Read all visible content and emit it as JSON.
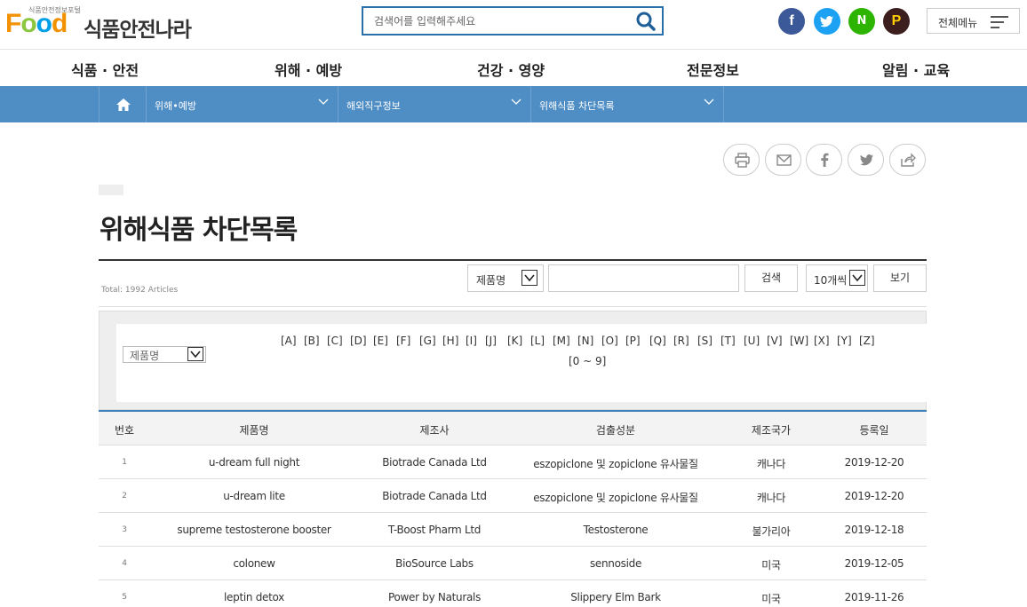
{
  "header": {
    "logo_small": "식품안전정보포털",
    "logo_food": [
      "F",
      "o",
      "o",
      "d"
    ],
    "logo_name": "식품안전나라",
    "search_placeholder": "검색어를 입력해주세요",
    "sns": {
      "facebook": "f",
      "naver": "N",
      "kakao": "P"
    },
    "menu_all": "전체메뉴"
  },
  "gnb": [
    "식품 · 안전",
    "위해 · 예방",
    "건강 · 영양",
    "전문정보",
    "알림 · 교육"
  ],
  "location": [
    "위해•예방",
    "해외직구정보",
    "위해식품 차단목록"
  ],
  "page_title": "위해식품 차단목록",
  "toolbar": {
    "total": "Total: 1992 Articles",
    "field_select": "제품명",
    "search_button": "검색",
    "count_select": "10개씩",
    "view_button": "보기"
  },
  "alpha": {
    "select": "제품명",
    "letters": [
      "[A]",
      "[B]",
      "[C]",
      "[D]",
      "[E]",
      "[F]",
      "[G]",
      "[H]",
      "[I]",
      "[J]",
      "[K]",
      "[L]",
      "[M]",
      "[N]",
      "[O]",
      "[P]",
      "[Q]",
      "[R]",
      "[S]",
      "[T]",
      "[U]",
      "[V]",
      "[W]",
      "[X]",
      "[Y]",
      "[Z]"
    ],
    "digits": "[0 ~ 9]"
  },
  "table": {
    "headers": [
      "번호",
      "제품명",
      "제조사",
      "검출성분",
      "제조국가",
      "등록일"
    ],
    "rows": [
      [
        "1",
        "u-dream full night",
        "Biotrade Canada Ltd",
        "eszopiclone 및 zopiclone 유사물질",
        "캐나다",
        "2019-12-20"
      ],
      [
        "2",
        "u-dream lite",
        "Biotrade Canada Ltd",
        "eszopiclone 및 zopiclone 유사물질",
        "캐나다",
        "2019-12-20"
      ],
      [
        "3",
        "supreme testosterone booster",
        "T-Boost Pharm Ltd",
        "Testosterone",
        "불가리아",
        "2019-12-18"
      ],
      [
        "4",
        "colonew",
        "BioSource Labs",
        "sennoside",
        "미국",
        "2019-12-05"
      ],
      [
        "5",
        "leptin detox",
        "Power by Naturals",
        "Slippery Elm Bark",
        "미국",
        "2019-11-26"
      ]
    ]
  }
}
